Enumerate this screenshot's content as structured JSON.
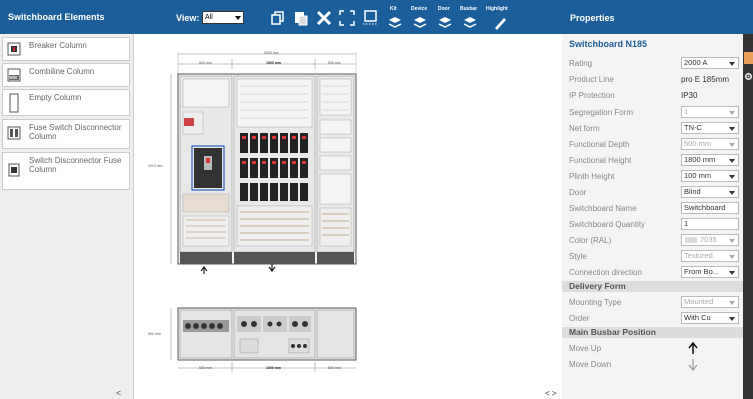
{
  "topbar": {
    "left_title": "Switchboard Elements",
    "view_label": "View:",
    "view_value": "All",
    "toolbar_labels": {
      "kit": "Kit",
      "device": "Device",
      "door": "Door",
      "busbar": "Busbar",
      "highlight": "Highlight"
    },
    "right_title": "Properties"
  },
  "palette": {
    "items": [
      {
        "label": "Breaker Column"
      },
      {
        "label": "Combiline Column"
      },
      {
        "label": "Empty Column"
      },
      {
        "label": "Fuse Switch Disconnector Column"
      },
      {
        "label": "Switch Disconnector Fuse Column"
      }
    ],
    "collapse": "<"
  },
  "canvas": {
    "dim_top_total": "2000 mm",
    "dim_col_left": "500 mm",
    "dim_col_mid": "1000 mm",
    "dim_col_right": "500 mm",
    "dim_height": "2013 mm",
    "dim_depth": "500 mm",
    "pager": "< >"
  },
  "properties": {
    "heading": "Switchboard N185",
    "rows": [
      {
        "key": "Rating",
        "value": "2000 A",
        "type": "select"
      },
      {
        "key": "Product Line",
        "value": "pro E 185mm",
        "type": "text"
      },
      {
        "key": "IP Protection",
        "value": "IP30",
        "type": "text"
      },
      {
        "key": "Segregation Form",
        "value": "1",
        "type": "select-disabled"
      },
      {
        "key": "Net form",
        "value": "TN-C",
        "type": "select"
      },
      {
        "key": "Functional Depth",
        "value": "500 mm",
        "type": "select-disabled"
      },
      {
        "key": "Functional Height",
        "value": "1800 mm",
        "type": "select"
      },
      {
        "key": "Plinth Height",
        "value": "100 mm",
        "type": "select"
      },
      {
        "key": "Door",
        "value": "Blind",
        "type": "select"
      },
      {
        "key": "Switchboard Name",
        "value": "Switchboard",
        "type": "input"
      },
      {
        "key": "Switchboard Quantity",
        "value": "1",
        "type": "input"
      },
      {
        "key": "Color (RAL)",
        "value": "7035",
        "type": "select-disabled"
      },
      {
        "key": "Style",
        "value": "Textured",
        "type": "select-disabled"
      },
      {
        "key": "Connection direction",
        "value": "From Bo...",
        "type": "select"
      }
    ],
    "section_delivery": "Delivery Form",
    "delivery_rows": [
      {
        "key": "Mounting Type",
        "value": "Mounted",
        "type": "select-disabled"
      },
      {
        "key": "Order",
        "value": "With Cu",
        "type": "select"
      }
    ],
    "section_busbar": "Main Busbar Position",
    "move_up": "Move Up",
    "move_down": "Move Down",
    "checkmark": "✓"
  },
  "colors": {
    "topbar": "#1c5e99",
    "accent_tab": "#e8a05a"
  }
}
